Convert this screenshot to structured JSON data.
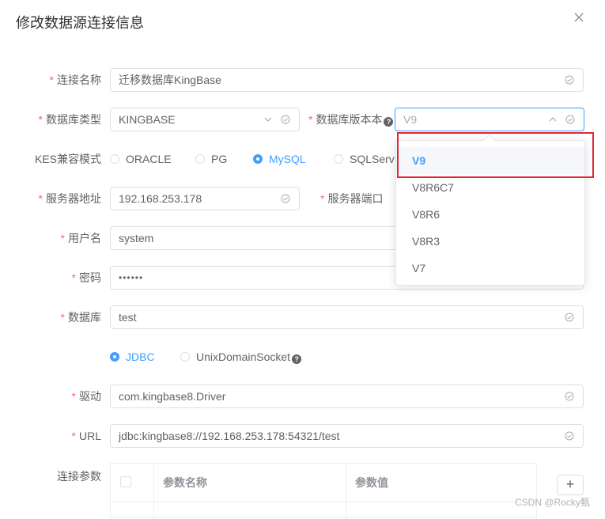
{
  "dialog": {
    "title": "修改数据源连接信息"
  },
  "form": {
    "conn_name": {
      "label": "连接名称",
      "value": "迁移数据库KingBase"
    },
    "db_type": {
      "label": "数据库类型",
      "value": "KINGBASE"
    },
    "db_version": {
      "label": "数据库版本本",
      "placeholder": "V9",
      "help": "?"
    },
    "kes_mode": {
      "label": "KES兼容模式",
      "options": [
        "ORACLE",
        "PG",
        "MySQL",
        "SQLServ"
      ],
      "selected": "MySQL"
    },
    "server_addr": {
      "label": "服务器地址",
      "value": "192.168.253.178"
    },
    "server_port": {
      "label": "服务器端口"
    },
    "username": {
      "label": "用户名",
      "value": "system"
    },
    "password": {
      "label": "密码",
      "value": "••••••"
    },
    "database": {
      "label": "数据库",
      "value": "test"
    },
    "conn_mode": {
      "options": [
        "JDBC",
        "UnixDomainSocket"
      ],
      "selected": "JDBC",
      "help": "?"
    },
    "driver": {
      "label": "驱动",
      "value": "com.kingbase8.Driver"
    },
    "url": {
      "label": "URL",
      "value": "jdbc:kingbase8://192.168.253.178:54321/test"
    },
    "params": {
      "label": "连接参数",
      "col_name": "参数名称",
      "col_value": "参数值",
      "add": "+"
    }
  },
  "version_dropdown": {
    "options": [
      "V9",
      "V8R6C7",
      "V8R6",
      "V8R3",
      "V7"
    ],
    "selected": "V9"
  },
  "watermark": "CSDN @Rocky甄",
  "colors": {
    "accent": "#409eff",
    "required": "#f56c6c",
    "highlight": "#e0282e"
  }
}
